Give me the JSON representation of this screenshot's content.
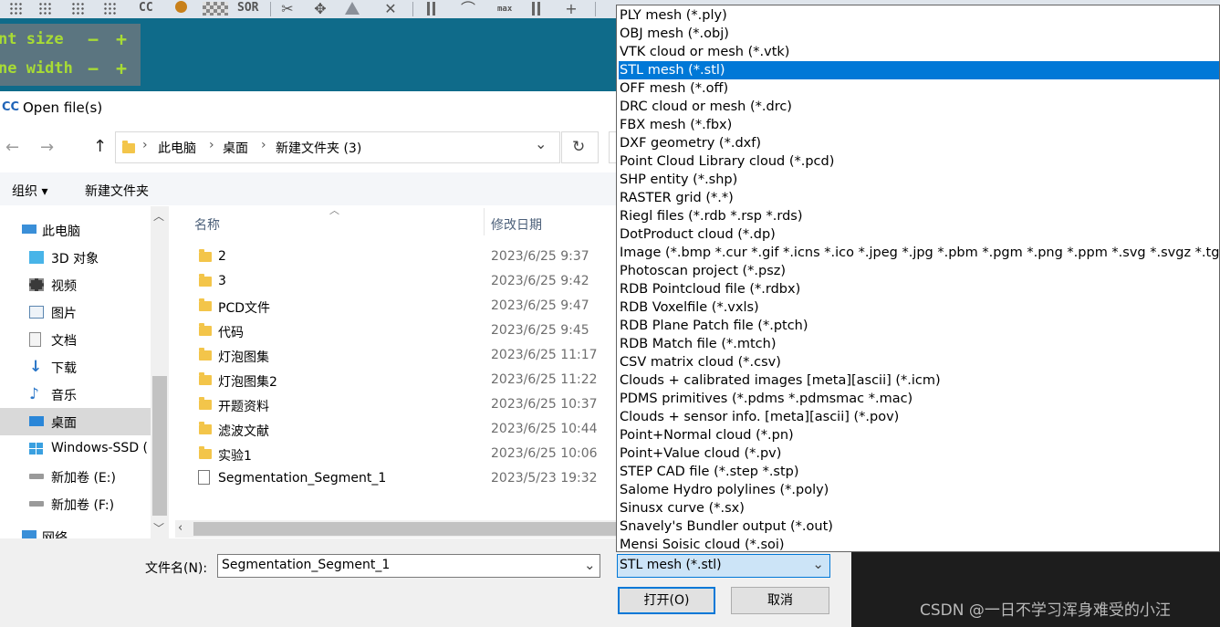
{
  "app": {
    "toolbar_texts": {
      "cc": "CC",
      "sor": "SOR",
      "max": "max"
    },
    "overlay": {
      "point_size": "nt size",
      "line_width": "ne width",
      "minus": "−",
      "plus": "+"
    },
    "watermark": "CSDN @一日不学习浑身难受的小汪"
  },
  "dialog": {
    "title_icon": "CC",
    "title": "Open file(s)",
    "nav": {
      "back": "←",
      "forward": "→",
      "up": "↑",
      "dropdown": "⌄",
      "refresh": "↻"
    },
    "breadcrumb": [
      "此电脑",
      "桌面",
      "新建文件夹 (3)"
    ],
    "breadcrumb_sep": "›",
    "commands": {
      "organize": "组织 ▾",
      "new_folder": "新建文件夹"
    },
    "sidebar": {
      "items": [
        {
          "label": "此电脑",
          "icon": "computer-icon"
        },
        {
          "label": "3D 对象",
          "icon": "cube-icon"
        },
        {
          "label": "视频",
          "icon": "film-icon"
        },
        {
          "label": "图片",
          "icon": "picture-icon"
        },
        {
          "label": "文档",
          "icon": "document-icon"
        },
        {
          "label": "下载",
          "icon": "download-icon"
        },
        {
          "label": "音乐",
          "icon": "music-icon"
        },
        {
          "label": "桌面",
          "icon": "desktop-icon",
          "selected": true
        },
        {
          "label": "Windows-SSD (",
          "icon": "windows-drive-icon"
        },
        {
          "label": "新加卷 (E:)",
          "icon": "drive-icon"
        },
        {
          "label": "新加卷 (F:)",
          "icon": "drive-icon"
        },
        {
          "label": "网络",
          "icon": "network-icon"
        }
      ]
    },
    "columns": {
      "name": "名称",
      "modified": "修改日期"
    },
    "files": [
      {
        "name": "2",
        "date": "2023/6/25 9:37",
        "type": "folder"
      },
      {
        "name": "3",
        "date": "2023/6/25 9:42",
        "type": "folder"
      },
      {
        "name": "PCD文件",
        "date": "2023/6/25 9:47",
        "type": "folder"
      },
      {
        "name": "代码",
        "date": "2023/6/25 9:45",
        "type": "folder"
      },
      {
        "name": "灯泡图集",
        "date": "2023/6/25 11:17",
        "type": "folder"
      },
      {
        "name": "灯泡图集2",
        "date": "2023/6/25 11:22",
        "type": "folder"
      },
      {
        "name": "开题资料",
        "date": "2023/6/25 10:37",
        "type": "folder"
      },
      {
        "name": "滤波文献",
        "date": "2023/6/25 10:44",
        "type": "folder"
      },
      {
        "name": "实验1",
        "date": "2023/6/25 10:06",
        "type": "folder"
      },
      {
        "name": "Segmentation_Segment_1",
        "date": "2023/5/23 19:32",
        "type": "file"
      }
    ],
    "filename_label": "文件名(N):",
    "filename_value": "Segmentation_Segment_1",
    "filetype_value": "STL mesh (*.stl)",
    "open_button": "打开(O)",
    "cancel_button": "取消",
    "filetype_options": [
      "PLY mesh (*.ply)",
      "OBJ mesh (*.obj)",
      "VTK cloud or mesh (*.vtk)",
      "STL mesh (*.stl)",
      "OFF mesh (*.off)",
      "DRC cloud or mesh (*.drc)",
      "FBX mesh (*.fbx)",
      "DXF geometry (*.dxf)",
      "Point Cloud Library cloud (*.pcd)",
      "SHP entity (*.shp)",
      "RASTER grid (*.*)",
      "Riegl files (*.rdb *.rsp *.rds)",
      "DotProduct cloud (*.dp)",
      "Image (*.bmp *.cur *.gif *.icns *.ico *.jpeg *.jpg *.pbm *.pgm *.png *.ppm *.svg *.svgz *.tga",
      "Photoscan project (*.psz)",
      "RDB Pointcloud file (*.rdbx)",
      "RDB Voxelfile (*.vxls)",
      "RDB Plane Patch file (*.ptch)",
      "RDB Match file (*.mtch)",
      "CSV matrix cloud (*.csv)",
      "Clouds + calibrated images [meta][ascii] (*.icm)",
      "PDMS primitives (*.pdms *.pdmsmac *.mac)",
      "Clouds + sensor info. [meta][ascii] (*.pov)",
      "Point+Normal cloud (*.pn)",
      "Point+Value cloud (*.pv)",
      "STEP CAD file (*.step *.stp)",
      "Salome Hydro polylines (*.poly)",
      "Sinusx curve (*.sx)",
      "Snavely's Bundler output (*.out)",
      "Mensi Soisic cloud (*.soi)"
    ],
    "selected_option_index": 3
  },
  "colors": {
    "accent": "#0078d7",
    "viewport": "#0f6b8a",
    "overlay_text": "#a8dc34"
  }
}
